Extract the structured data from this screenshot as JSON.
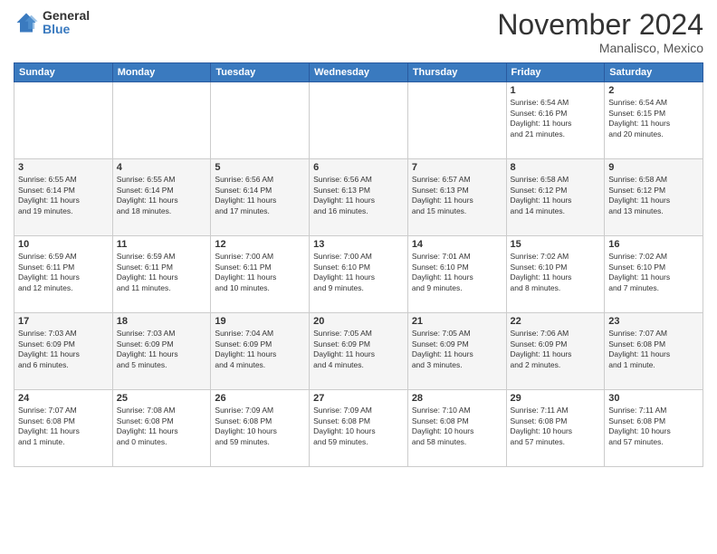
{
  "logo": {
    "general": "General",
    "blue": "Blue"
  },
  "header": {
    "month": "November 2024",
    "location": "Manalisco, Mexico"
  },
  "weekdays": [
    "Sunday",
    "Monday",
    "Tuesday",
    "Wednesday",
    "Thursday",
    "Friday",
    "Saturday"
  ],
  "weeks": [
    [
      {
        "day": "",
        "info": ""
      },
      {
        "day": "",
        "info": ""
      },
      {
        "day": "",
        "info": ""
      },
      {
        "day": "",
        "info": ""
      },
      {
        "day": "",
        "info": ""
      },
      {
        "day": "1",
        "info": "Sunrise: 6:54 AM\nSunset: 6:16 PM\nDaylight: 11 hours\nand 21 minutes."
      },
      {
        "day": "2",
        "info": "Sunrise: 6:54 AM\nSunset: 6:15 PM\nDaylight: 11 hours\nand 20 minutes."
      }
    ],
    [
      {
        "day": "3",
        "info": "Sunrise: 6:55 AM\nSunset: 6:14 PM\nDaylight: 11 hours\nand 19 minutes."
      },
      {
        "day": "4",
        "info": "Sunrise: 6:55 AM\nSunset: 6:14 PM\nDaylight: 11 hours\nand 18 minutes."
      },
      {
        "day": "5",
        "info": "Sunrise: 6:56 AM\nSunset: 6:14 PM\nDaylight: 11 hours\nand 17 minutes."
      },
      {
        "day": "6",
        "info": "Sunrise: 6:56 AM\nSunset: 6:13 PM\nDaylight: 11 hours\nand 16 minutes."
      },
      {
        "day": "7",
        "info": "Sunrise: 6:57 AM\nSunset: 6:13 PM\nDaylight: 11 hours\nand 15 minutes."
      },
      {
        "day": "8",
        "info": "Sunrise: 6:58 AM\nSunset: 6:12 PM\nDaylight: 11 hours\nand 14 minutes."
      },
      {
        "day": "9",
        "info": "Sunrise: 6:58 AM\nSunset: 6:12 PM\nDaylight: 11 hours\nand 13 minutes."
      }
    ],
    [
      {
        "day": "10",
        "info": "Sunrise: 6:59 AM\nSunset: 6:11 PM\nDaylight: 11 hours\nand 12 minutes."
      },
      {
        "day": "11",
        "info": "Sunrise: 6:59 AM\nSunset: 6:11 PM\nDaylight: 11 hours\nand 11 minutes."
      },
      {
        "day": "12",
        "info": "Sunrise: 7:00 AM\nSunset: 6:11 PM\nDaylight: 11 hours\nand 10 minutes."
      },
      {
        "day": "13",
        "info": "Sunrise: 7:00 AM\nSunset: 6:10 PM\nDaylight: 11 hours\nand 9 minutes."
      },
      {
        "day": "14",
        "info": "Sunrise: 7:01 AM\nSunset: 6:10 PM\nDaylight: 11 hours\nand 9 minutes."
      },
      {
        "day": "15",
        "info": "Sunrise: 7:02 AM\nSunset: 6:10 PM\nDaylight: 11 hours\nand 8 minutes."
      },
      {
        "day": "16",
        "info": "Sunrise: 7:02 AM\nSunset: 6:10 PM\nDaylight: 11 hours\nand 7 minutes."
      }
    ],
    [
      {
        "day": "17",
        "info": "Sunrise: 7:03 AM\nSunset: 6:09 PM\nDaylight: 11 hours\nand 6 minutes."
      },
      {
        "day": "18",
        "info": "Sunrise: 7:03 AM\nSunset: 6:09 PM\nDaylight: 11 hours\nand 5 minutes."
      },
      {
        "day": "19",
        "info": "Sunrise: 7:04 AM\nSunset: 6:09 PM\nDaylight: 11 hours\nand 4 minutes."
      },
      {
        "day": "20",
        "info": "Sunrise: 7:05 AM\nSunset: 6:09 PM\nDaylight: 11 hours\nand 4 minutes."
      },
      {
        "day": "21",
        "info": "Sunrise: 7:05 AM\nSunset: 6:09 PM\nDaylight: 11 hours\nand 3 minutes."
      },
      {
        "day": "22",
        "info": "Sunrise: 7:06 AM\nSunset: 6:09 PM\nDaylight: 11 hours\nand 2 minutes."
      },
      {
        "day": "23",
        "info": "Sunrise: 7:07 AM\nSunset: 6:08 PM\nDaylight: 11 hours\nand 1 minute."
      }
    ],
    [
      {
        "day": "24",
        "info": "Sunrise: 7:07 AM\nSunset: 6:08 PM\nDaylight: 11 hours\nand 1 minute."
      },
      {
        "day": "25",
        "info": "Sunrise: 7:08 AM\nSunset: 6:08 PM\nDaylight: 11 hours\nand 0 minutes."
      },
      {
        "day": "26",
        "info": "Sunrise: 7:09 AM\nSunset: 6:08 PM\nDaylight: 10 hours\nand 59 minutes."
      },
      {
        "day": "27",
        "info": "Sunrise: 7:09 AM\nSunset: 6:08 PM\nDaylight: 10 hours\nand 59 minutes."
      },
      {
        "day": "28",
        "info": "Sunrise: 7:10 AM\nSunset: 6:08 PM\nDaylight: 10 hours\nand 58 minutes."
      },
      {
        "day": "29",
        "info": "Sunrise: 7:11 AM\nSunset: 6:08 PM\nDaylight: 10 hours\nand 57 minutes."
      },
      {
        "day": "30",
        "info": "Sunrise: 7:11 AM\nSunset: 6:08 PM\nDaylight: 10 hours\nand 57 minutes."
      }
    ]
  ]
}
